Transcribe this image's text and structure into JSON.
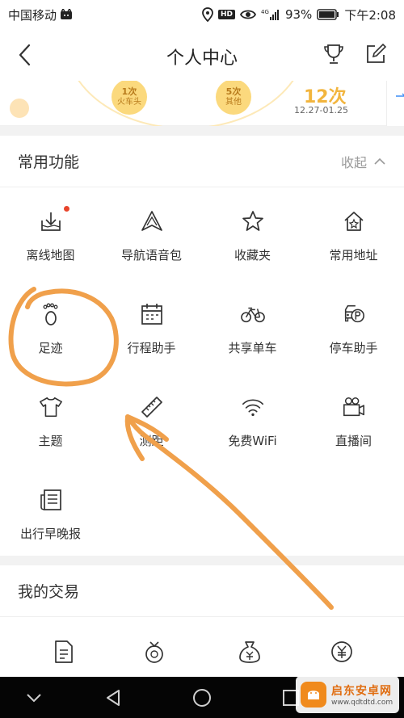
{
  "status_bar": {
    "carrier": "中国移动",
    "signal_label": "4G",
    "battery": "93%",
    "time": "下午2:08",
    "hd_label": "HD"
  },
  "header": {
    "title": "个人中心"
  },
  "stats": {
    "bubble_1": {
      "count": "1次",
      "label": "火车头"
    },
    "bubble_2": {
      "count": "5次",
      "label": "其他"
    },
    "total_count": "12次",
    "date_range": "12.27-01.25"
  },
  "common_functions": {
    "title": "常用功能",
    "collapse_label": "收起",
    "items": [
      {
        "label": "离线地图",
        "icon": "download-map-icon"
      },
      {
        "label": "导航语音包",
        "icon": "navigation-voice-icon"
      },
      {
        "label": "收藏夹",
        "icon": "star-icon"
      },
      {
        "label": "常用地址",
        "icon": "home-star-icon"
      },
      {
        "label": "足迹",
        "icon": "footprint-icon"
      },
      {
        "label": "行程助手",
        "icon": "calendar-icon"
      },
      {
        "label": "共享单车",
        "icon": "bicycle-icon"
      },
      {
        "label": "停车助手",
        "icon": "parking-car-icon"
      },
      {
        "label": "主题",
        "icon": "tshirt-icon"
      },
      {
        "label": "测距",
        "icon": "ruler-icon"
      },
      {
        "label": "免费WiFi",
        "icon": "wifi-icon"
      },
      {
        "label": "直播间",
        "icon": "video-camera-icon"
      },
      {
        "label": "出行早晚报",
        "icon": "newspaper-icon"
      }
    ]
  },
  "my_transactions": {
    "title": "我的交易",
    "icons": [
      "document-icon",
      "coin-bag-icon",
      "money-bag-icon",
      "yuan-circle-icon"
    ]
  },
  "watermark": {
    "title": "启东安卓网",
    "url": "www.qdtdtd.com"
  },
  "colors": {
    "annotation": "#f0a04b",
    "accent_yellow": "#f2b53e",
    "badge_red": "#e8452c"
  }
}
